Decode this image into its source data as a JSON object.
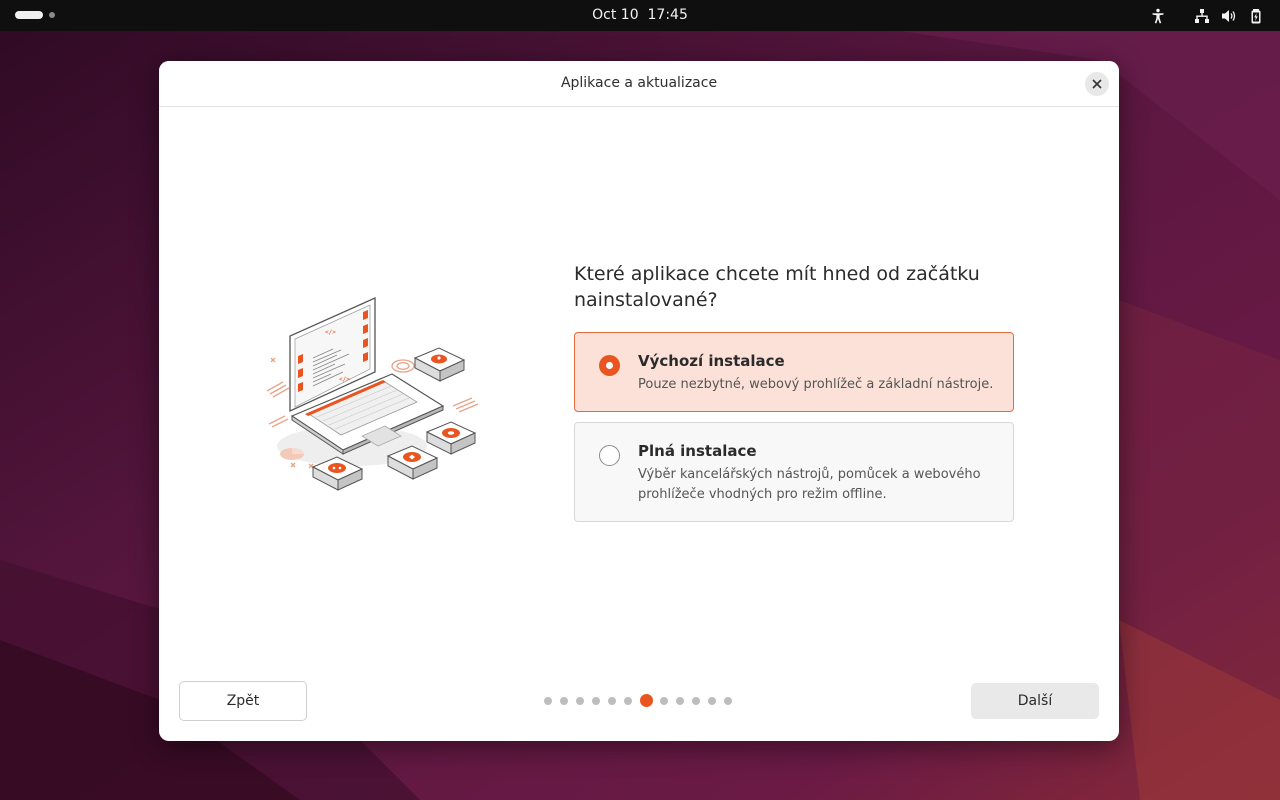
{
  "topbar": {
    "date": "Oct 10",
    "time": "17:45",
    "tray_icons": [
      "accessibility-icon",
      "network-icon",
      "volume-icon",
      "battery-icon"
    ]
  },
  "dialog": {
    "title": "Aplikace a aktualizace",
    "question": "Které aplikace chcete mít hned od začátku nainstalované?",
    "options": [
      {
        "title": "Výchozí instalace",
        "description": "Pouze nezbytné, webový prohlížeč a základní nástroje.",
        "selected": true
      },
      {
        "title": "Plná instalace",
        "description": "Výběr kancelářských nástrojů, pomůcek a webového prohlížeče vhodných pro režim offline.",
        "selected": false
      }
    ],
    "back_label": "Zpět",
    "next_label": "Další",
    "pager": {
      "total": 12,
      "current": 7
    }
  },
  "colors": {
    "accent": "#e95420",
    "selected_bg": "#fce1d8",
    "topbar_bg": "#0f0f0f",
    "wallpaper": "#4a1238"
  }
}
